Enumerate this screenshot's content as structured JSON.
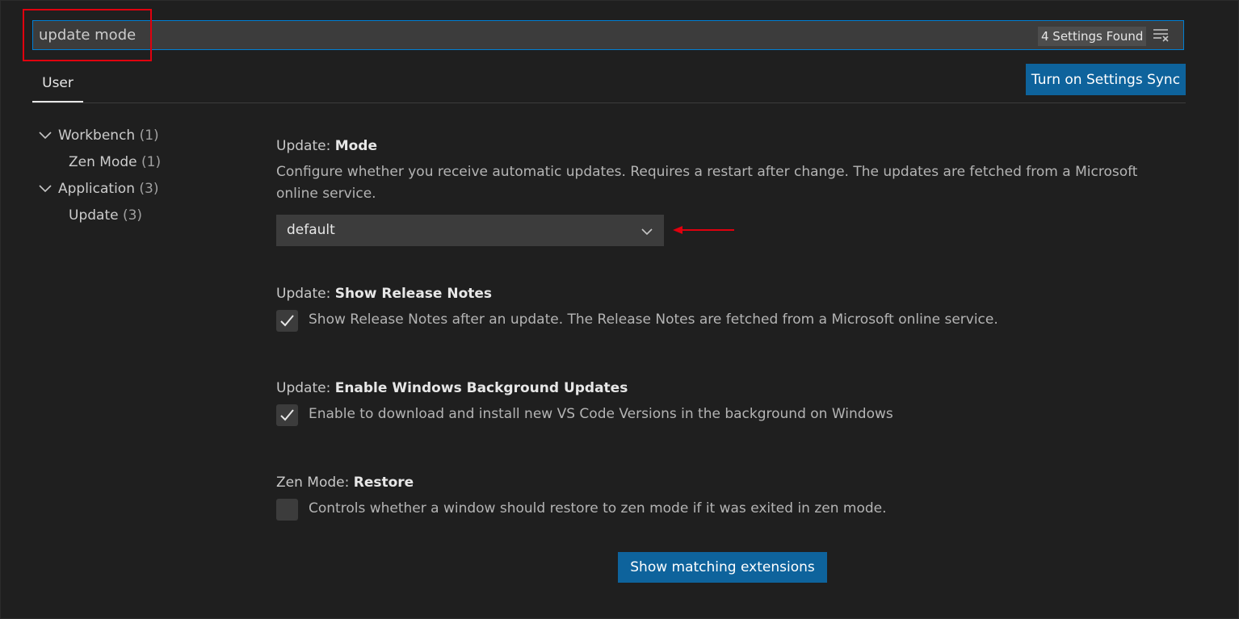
{
  "search": {
    "value": "update mode",
    "result_count": "4 Settings Found",
    "clear_icon": "clear-filter-icon"
  },
  "tabs": [
    {
      "label": "User",
      "active": true
    }
  ],
  "sync_button": "Turn on Settings Sync",
  "toc": [
    {
      "label": "Workbench",
      "count": "(1)",
      "expanded": true
    },
    {
      "label": "Zen Mode",
      "count": "(1)"
    },
    {
      "label": "Application",
      "count": "(3)",
      "expanded": true
    },
    {
      "label": "Update",
      "count": "(3)"
    }
  ],
  "settings": {
    "update_mode": {
      "category": "Update: ",
      "key": "Mode",
      "description": "Configure whether you receive automatic updates. Requires a restart after change. The updates are fetched from a Microsoft online service.",
      "selected": "default"
    },
    "show_release_notes": {
      "category": "Update: ",
      "key": "Show Release Notes",
      "description": "Show Release Notes after an update. The Release Notes are fetched from a Microsoft online service.",
      "checked": true
    },
    "windows_background": {
      "category": "Update: ",
      "key": "Enable Windows Background Updates",
      "description": "Enable to download and install new VS Code Versions in the background on Windows",
      "checked": true
    },
    "zen_restore": {
      "category": "Zen Mode: ",
      "key": "Restore",
      "description": "Controls whether a window should restore to zen mode if it was exited in zen mode.",
      "checked": false
    }
  },
  "extensions_button": "Show matching extensions",
  "colors": {
    "background": "#1f1f1f",
    "accent_button": "#0e639c",
    "focus_border": "#007fd4",
    "annotation_red": "#e0000e"
  }
}
